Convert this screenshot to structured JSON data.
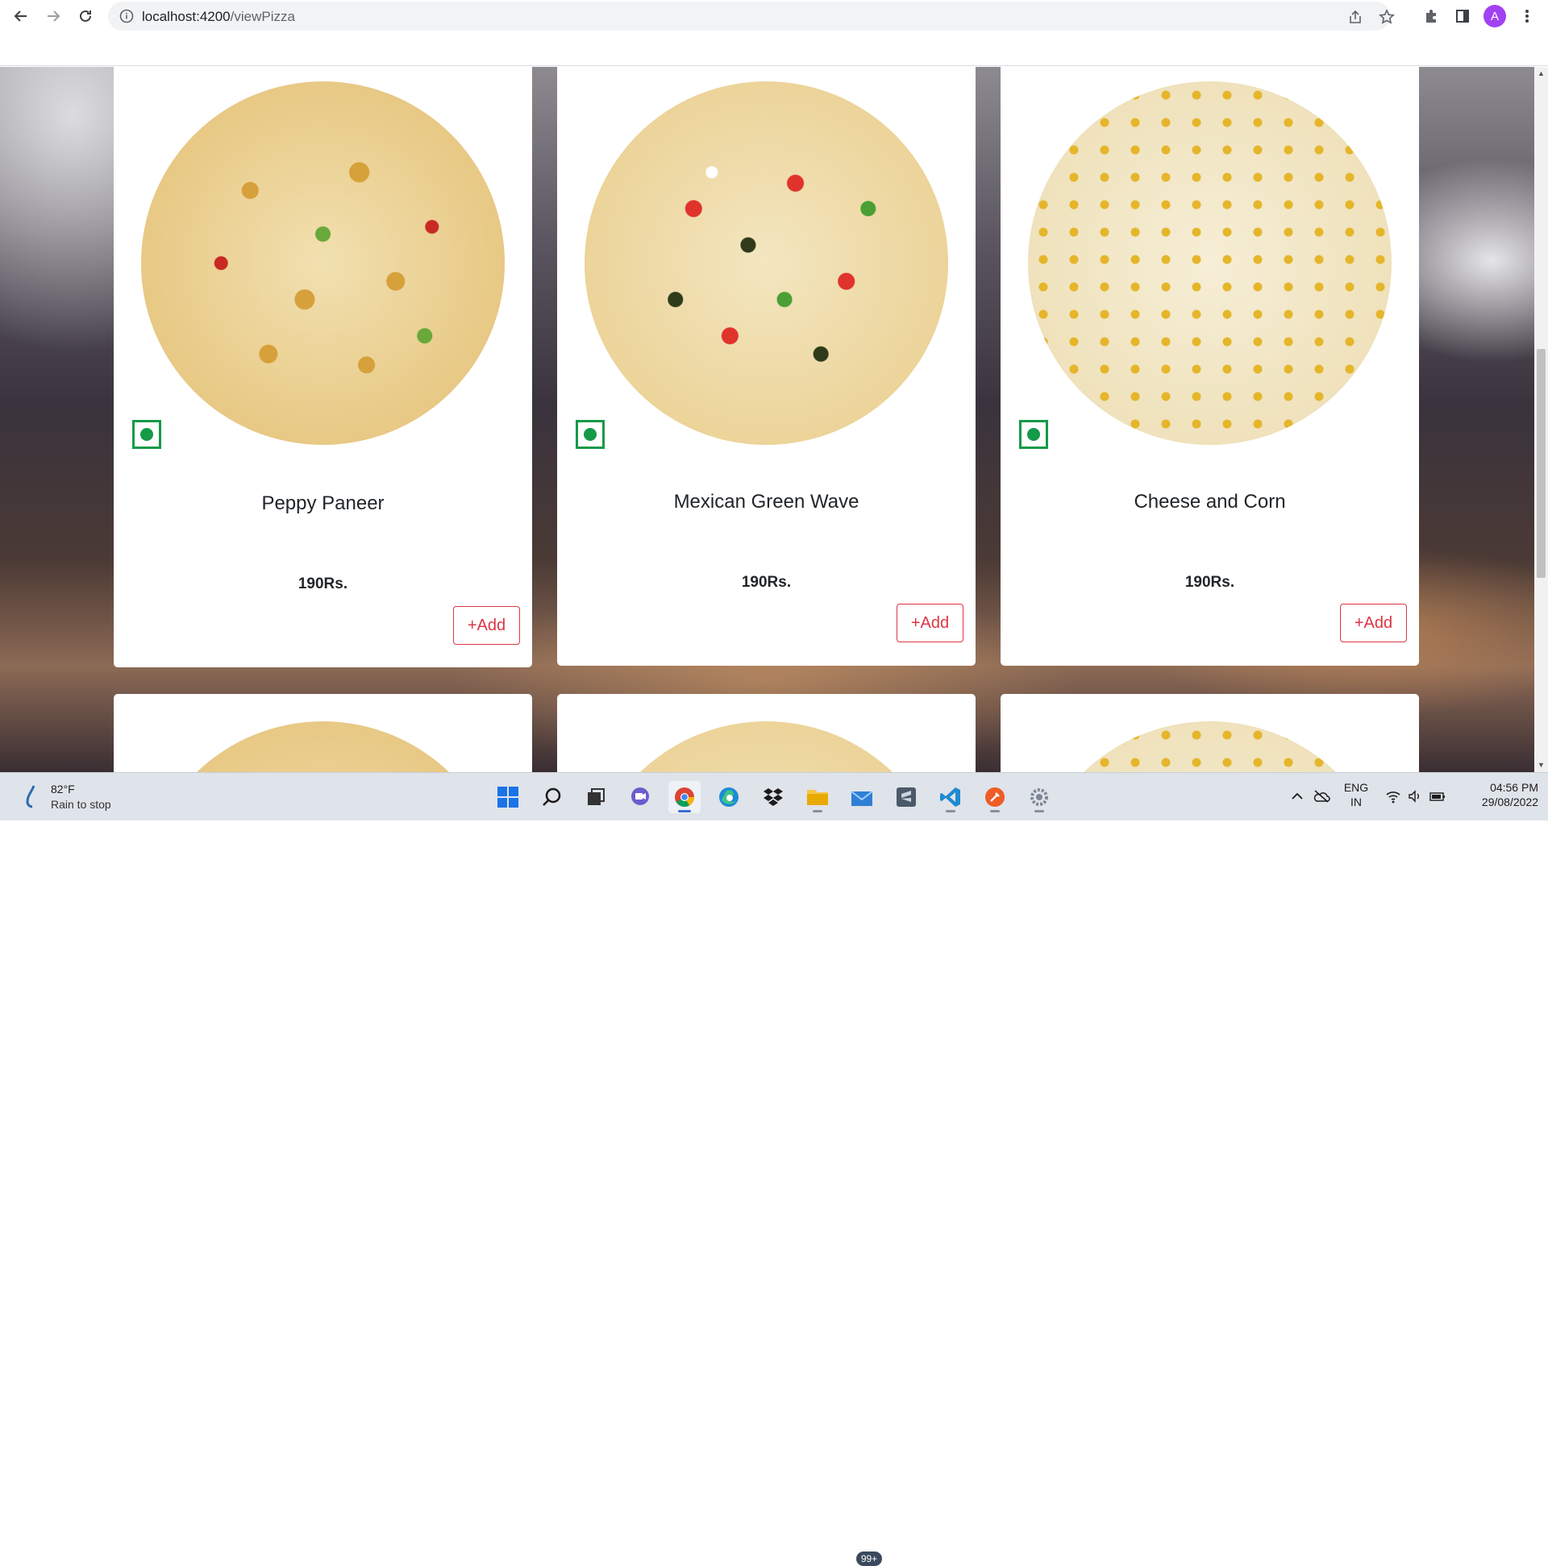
{
  "browser": {
    "url_host": "localhost:4200",
    "url_path": "/viewPizza",
    "profile_initial": "A"
  },
  "pizzas": [
    {
      "name": "Peppy Paneer",
      "price": "190Rs.",
      "add_label": "+Add",
      "veg": true
    },
    {
      "name": "Mexican Green Wave",
      "price": "190Rs.",
      "add_label": "+Add",
      "veg": true
    },
    {
      "name": "Cheese and Corn",
      "price": "190Rs.",
      "add_label": "+Add",
      "veg": true
    }
  ],
  "taskbar": {
    "weather_temp": "82°F",
    "weather_status": "Rain to stop",
    "mail_badge": "99+",
    "language_line1": "ENG",
    "language_line2": "IN",
    "time": "04:56 PM",
    "date": "29/08/2022"
  },
  "colors": {
    "add_button": "#dc3545",
    "veg_mark": "#159a48",
    "profile": "#a142f4"
  }
}
